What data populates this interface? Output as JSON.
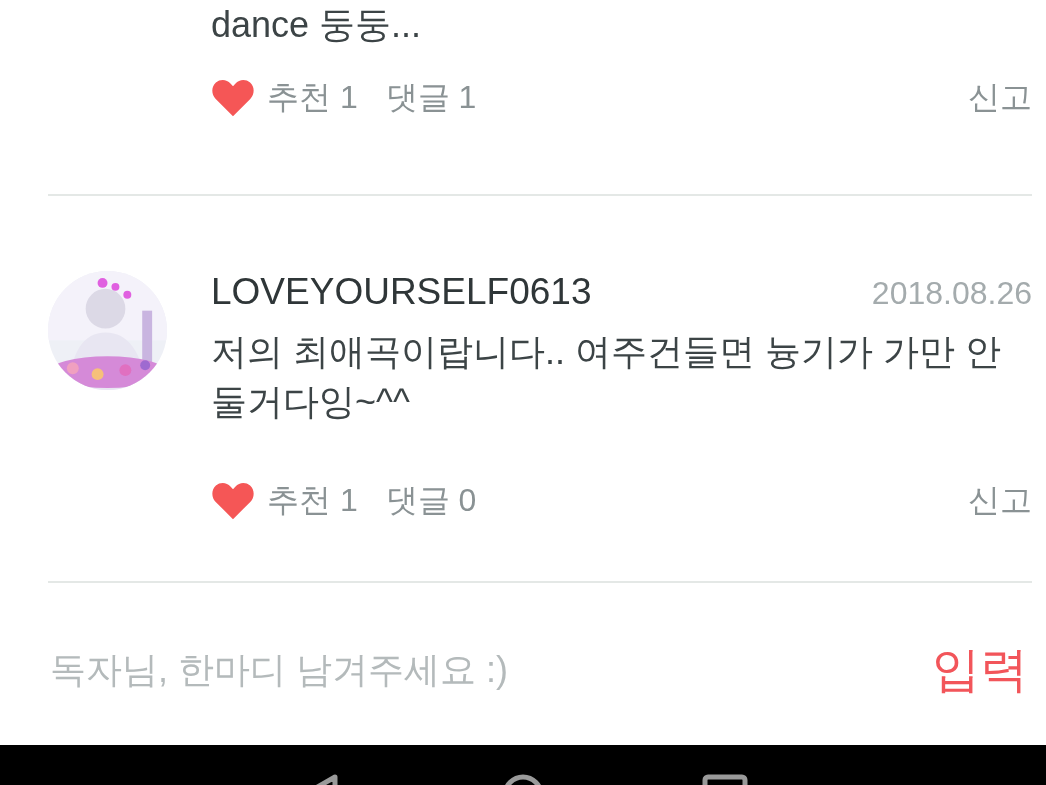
{
  "comments": [
    {
      "text": "dance 둥둥...",
      "likes": "추천 1",
      "replies": "댓글 1",
      "report": "신고"
    },
    {
      "author": "LOVEYOURSELF0613",
      "date": "2018.08.26",
      "text": "저의 최애곡이랍니다.. 여주건들면 늉기가 가만 안둘거다잉~^^",
      "likes": "추천 1",
      "replies": "댓글 0",
      "report": "신고"
    }
  ],
  "input": {
    "placeholder": "독자님, 한마디 남겨주세요 :)",
    "submit": "입력"
  }
}
